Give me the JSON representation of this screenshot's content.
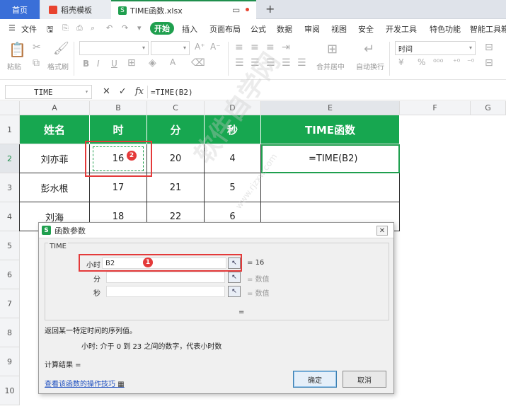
{
  "tabs": [
    {
      "label": "首页"
    },
    {
      "label": "稻壳模板"
    },
    {
      "label": "TIME函数.xlsx"
    }
  ],
  "menu": [
    "文件",
    "开始",
    "插入",
    "页面布局",
    "公式",
    "数据",
    "审阅",
    "视图",
    "安全",
    "开发工具",
    "特色功能",
    "智能工具箱"
  ],
  "ribbon": {
    "paste": "粘贴",
    "format_painter": "格式刷",
    "merge_center": "合并居中",
    "auto_wrap": "自动换行",
    "number_format": "时间"
  },
  "formula_bar": {
    "name_box": "TIME",
    "fx": "fx",
    "formula": "=TIME(B2)"
  },
  "columns": [
    "A",
    "B",
    "C",
    "D",
    "E",
    "F",
    "G"
  ],
  "rows": [
    "1",
    "2",
    "3",
    "4",
    "5",
    "6",
    "7",
    "8",
    "9",
    "10"
  ],
  "table": {
    "headers": [
      "姓名",
      "时",
      "分",
      "秒",
      "TIME函数"
    ],
    "data": [
      [
        "刘亦菲",
        "16",
        "20",
        "4",
        "=TIME(B2)"
      ],
      [
        "彭水根",
        "17",
        "21",
        "5",
        ""
      ],
      [
        "刘海",
        "18",
        "22",
        "6",
        ""
      ]
    ]
  },
  "dialog": {
    "title": "函数参数",
    "group": "TIME",
    "args": [
      {
        "label": "小时",
        "value": "B2",
        "result": "16"
      },
      {
        "label": "分",
        "value": "",
        "result": "数值"
      },
      {
        "label": "秒",
        "value": "",
        "result": "数值"
      }
    ],
    "eq": "=",
    "description": "返回某一特定时间的序列值。",
    "arg_help": "小时:  介于 0 到 23 之间的数字，代表小时数",
    "calc_result": "计算结果 =",
    "link": "查看该函数的操作技巧",
    "ok": "确定",
    "cancel": "取消"
  },
  "annotations": [
    "1",
    "2"
  ],
  "watermark": "软件自学网",
  "watermark_sub": "www.rjzxw.com",
  "colors": {
    "accent": "#17a750",
    "highlight": "#e43a3a",
    "tab": "#3a6fd8"
  }
}
